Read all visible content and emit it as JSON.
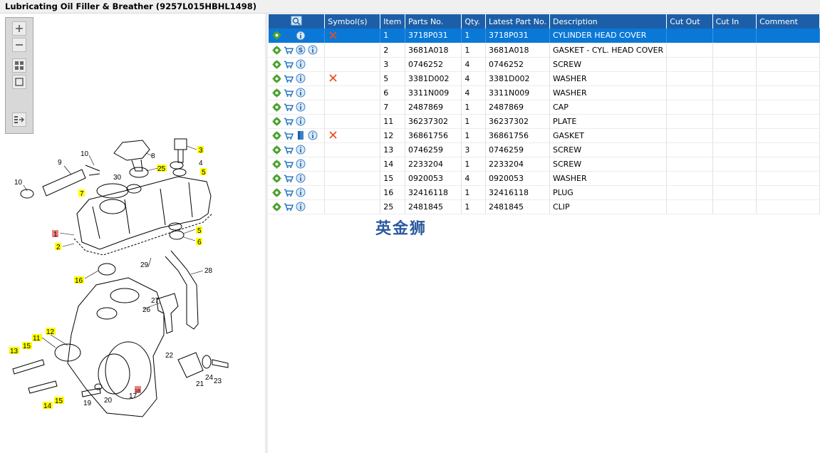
{
  "window": {
    "title": "Lubricating Oil Filler & Breather (9257L015HBHL1498)"
  },
  "toolbar": {
    "buttons": [
      {
        "icon": "zoom-in-icon"
      },
      {
        "icon": "zoom-out-icon"
      },
      {
        "icon": "fit-all-icon"
      },
      {
        "icon": "actual-size-icon"
      },
      {
        "icon": "toggle-panel-icon"
      }
    ]
  },
  "diagram": {
    "callouts": {
      "c1": "1",
      "c2": "2",
      "c3": "3",
      "c4": "4",
      "c5a": "5",
      "c5b": "5",
      "c6": "6",
      "c7": "7",
      "c8": "8",
      "c9": "9",
      "c10a": "10",
      "c10b": "10",
      "c11": "11",
      "c12": "12",
      "c13": "13",
      "c14": "14",
      "c15a": "15",
      "c15b": "15",
      "c16": "16",
      "c17": "17",
      "c18": "18",
      "c19": "19",
      "c20": "20",
      "c21": "21",
      "c22": "22",
      "c23": "23",
      "c24": "24",
      "c25": "25",
      "c26": "26",
      "c27": "27",
      "c28": "28",
      "c29": "29",
      "c30": "30"
    }
  },
  "grid": {
    "columns": {
      "symbols": "Symbol(s)",
      "item": "Item",
      "parts_no": "Parts No.",
      "qty": "Qty.",
      "latest_part_no": "Latest Part No.",
      "description": "Description",
      "cut_out": "Cut Out",
      "cut_in": "Cut In",
      "comment": "Comment"
    },
    "header_icon": "search-parts-icon",
    "rows": [
      {
        "item": "1",
        "parts_no": "3718P031",
        "qty": "1",
        "latest": "3718P031",
        "description": "CYLINDER HEAD COVER",
        "symbol": "x"
      },
      {
        "item": "2",
        "parts_no": "3681A018",
        "qty": "1",
        "latest": "3681A018",
        "description": "GASKET - CYL. HEAD COVER",
        "extra": "S"
      },
      {
        "item": "3",
        "parts_no": "0746252",
        "qty": "4",
        "latest": "0746252",
        "description": "SCREW"
      },
      {
        "item": "5",
        "parts_no": "3381D002",
        "qty": "4",
        "latest": "3381D002",
        "description": "WASHER",
        "symbol": "x"
      },
      {
        "item": "6",
        "parts_no": "3311N009",
        "qty": "4",
        "latest": "3311N009",
        "description": "WASHER"
      },
      {
        "item": "7",
        "parts_no": "2487869",
        "qty": "1",
        "latest": "2487869",
        "description": "CAP"
      },
      {
        "item": "11",
        "parts_no": "36237302",
        "qty": "1",
        "latest": "36237302",
        "description": "PLATE"
      },
      {
        "item": "12",
        "parts_no": "36861756",
        "qty": "1",
        "latest": "36861756",
        "description": "GASKET",
        "symbol": "x",
        "extra": "book"
      },
      {
        "item": "13",
        "parts_no": "0746259",
        "qty": "3",
        "latest": "0746259",
        "description": "SCREW"
      },
      {
        "item": "14",
        "parts_no": "2233204",
        "qty": "1",
        "latest": "2233204",
        "description": "SCREW"
      },
      {
        "item": "15",
        "parts_no": "0920053",
        "qty": "4",
        "latest": "0920053",
        "description": "WASHER"
      },
      {
        "item": "16",
        "parts_no": "32416118",
        "qty": "1",
        "latest": "32416118",
        "description": "PLUG"
      },
      {
        "item": "25",
        "parts_no": "2481845",
        "qty": "1",
        "latest": "2481845",
        "description": "CLIP"
      }
    ]
  },
  "watermark": {
    "text": "英金狮"
  },
  "colors": {
    "header_bg": "#1c5fa8",
    "selected_row": "#0a78d7",
    "callout_yellow": "#ffff00",
    "callout_red": "#f08080",
    "symbol_x": "#e8501e"
  }
}
